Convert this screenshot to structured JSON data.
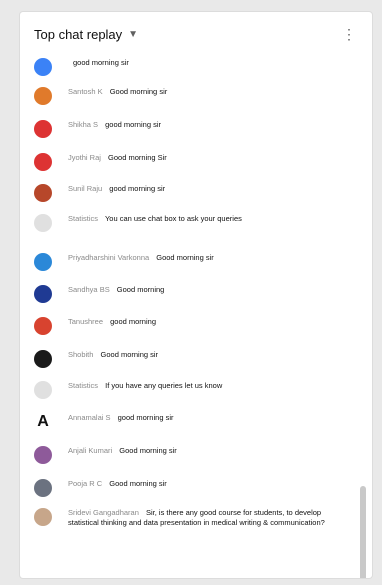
{
  "header": {
    "title": "Top chat replay",
    "chevron_icon": "chevron-down-icon",
    "more_icon": "more-vert-icon"
  },
  "messages": [
    {
      "author": "",
      "text": "good morning sir",
      "avatar_color": "#3b82f6",
      "avatar_letter": ""
    },
    {
      "author": "Santosh K",
      "text": "Good morning sir",
      "avatar_color": "#e07a2b",
      "avatar_letter": ""
    },
    {
      "author": "Shikha S",
      "text": "good morning sir",
      "avatar_color": "#d33",
      "avatar_letter": ""
    },
    {
      "author": "Jyothi Raj",
      "text": "Good morning Sir",
      "avatar_color": "#d33",
      "avatar_letter": ""
    },
    {
      "author": "Sunil Raju",
      "text": "good morning sir",
      "avatar_color": "#b7472a",
      "avatar_letter": ""
    },
    {
      "author": "Statistics",
      "text": "You can use chat box to ask your queries",
      "avatar_color": "#e0e0e0",
      "avatar_letter": ""
    },
    {
      "author": "Priyadharshini Varkonna",
      "text": "Good morning sir",
      "avatar_color": "#2b88d8",
      "avatar_letter": ""
    },
    {
      "author": "Sandhya BS",
      "text": "Good morning",
      "avatar_color": "#1f3a93",
      "avatar_letter": ""
    },
    {
      "author": "Tanushree",
      "text": "good morning",
      "avatar_color": "#d8432f",
      "avatar_letter": ""
    },
    {
      "author": "Shobith",
      "text": "Good morning sir",
      "avatar_color": "#1a1a1a",
      "avatar_letter": ""
    },
    {
      "author": "Statistics",
      "text": "If you have any queries let us know",
      "avatar_color": "#e0e0e0",
      "avatar_letter": ""
    },
    {
      "author": "Annamalai S",
      "text": "good morning sir",
      "avatar_color": "#ffffff",
      "avatar_letter": "A"
    },
    {
      "author": "Anjali Kumari",
      "text": "Good morning sir",
      "avatar_color": "#8e5a9a",
      "avatar_letter": ""
    },
    {
      "author": "Pooja R C",
      "text": "Good morning sir",
      "avatar_color": "#6b7280",
      "avatar_letter": ""
    },
    {
      "author": "Sridevi Gangadharan",
      "text": "Sir, is there any good course for students, to develop statistical thinking and data presentation in medical writing & communication?",
      "avatar_color": "#c7a68a",
      "avatar_letter": ""
    }
  ]
}
